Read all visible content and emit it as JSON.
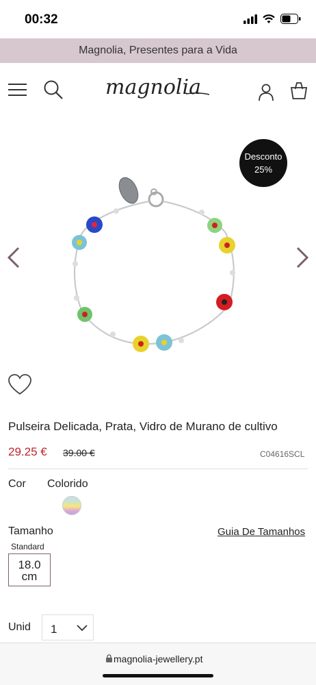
{
  "status_bar": {
    "time": "00:32"
  },
  "promo": {
    "text": "Magnolia, Presentes para a Vida"
  },
  "header": {
    "logo_text": "magnolia"
  },
  "product": {
    "discount_badge_line1": "Desconto",
    "discount_badge_line2": "25%",
    "title": "Pulseira Delicada, Prata, Vidro de Murano de cultivo",
    "price": "29.25 €",
    "old_price": "39.00 €",
    "sku": "C04616SCL"
  },
  "options": {
    "color_label": "Cor",
    "color_value": "Colorido",
    "size_label": "Tamanho",
    "size_guide": "Guia De Tamanhos",
    "size_type": "Standard",
    "size_value_line1": "18.0",
    "size_value_line2": "cm",
    "qty_label": "Unid",
    "qty_value": "1"
  },
  "browser": {
    "url": "magnolia-jewellery.pt"
  }
}
